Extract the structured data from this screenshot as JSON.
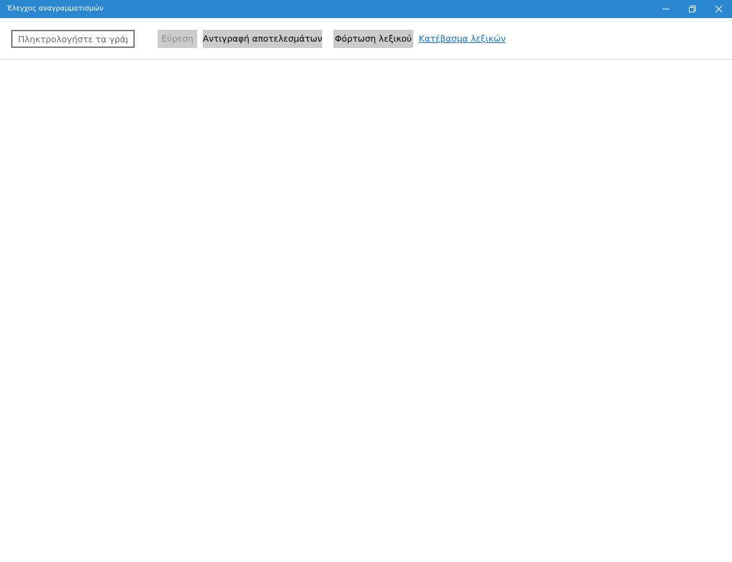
{
  "window": {
    "title": "Έλεγχος αναγραμματισμών",
    "titlebar_color": "#2b87d0",
    "controls": [
      "minimize-icon",
      "restore-icon",
      "close-icon"
    ]
  },
  "toolbar": {
    "input": {
      "placeholder": "Πληκτρολογήστε τα γράμματα",
      "value": ""
    },
    "find_label": "Εύρεση",
    "copy_label": "Αντιγραφή αποτελεσμάτων",
    "load_label": "Φόρτωση λεξικού",
    "download_link": "Κατέβασμα λεξικών",
    "link_color": "#1a72c6"
  }
}
